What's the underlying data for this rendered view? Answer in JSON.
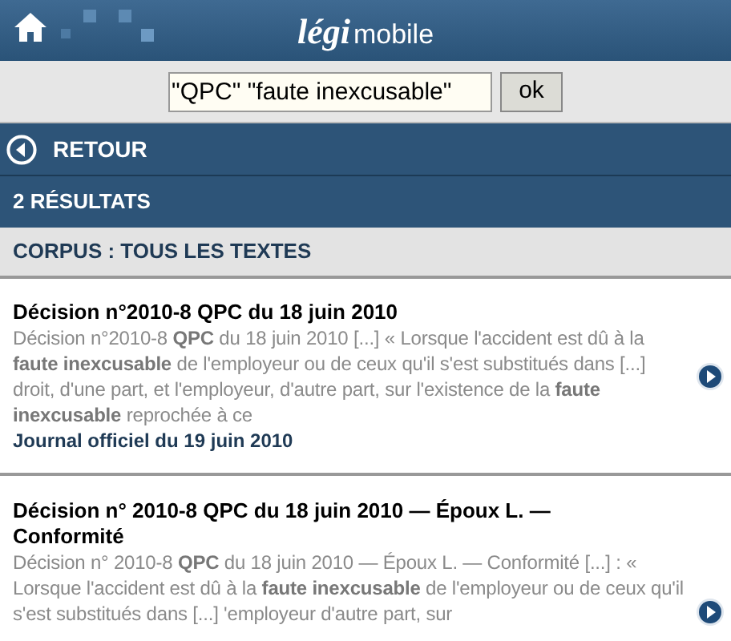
{
  "header": {
    "logo_part_1": "légi",
    "logo_part_2": "mobile"
  },
  "search": {
    "value": "\"QPC\" \"faute inexcusable\"",
    "button": "ok"
  },
  "back": {
    "label": "RETOUR"
  },
  "result_count": "2 RÉSULTATS",
  "corpus": "CORPUS : TOUS LES TEXTES",
  "results": [
    {
      "title": "Décision n°2010-8 QPC du 18 juin 2010",
      "snippet": "Décision n°2010-8 **QPC** du 18 juin 2010 [...] « Lorsque l'accident est dû à la **faute inexcusable** de l'employeur ou de ceux qu'il s'est substitués dans [...] droit, d'une part, et l'employeur, d'autre part, sur l'existence de la **faute inexcusable** reprochée à ce",
      "source": "Journal officiel du 19 juin 2010"
    },
    {
      "title": "Décision n° 2010-8 QPC du 18 juin 2010 — Époux L. — Conformité",
      "snippet": "Décision n° 2010-8 **QPC** du 18 juin 2010 — Époux L. — Conformité [...] : « Lorsque l'accident est dû à la **faute inexcusable** de l'employeur ou de ceux qu'il s'est substitués dans [...] 'employeur d'autre part, sur"
    }
  ]
}
